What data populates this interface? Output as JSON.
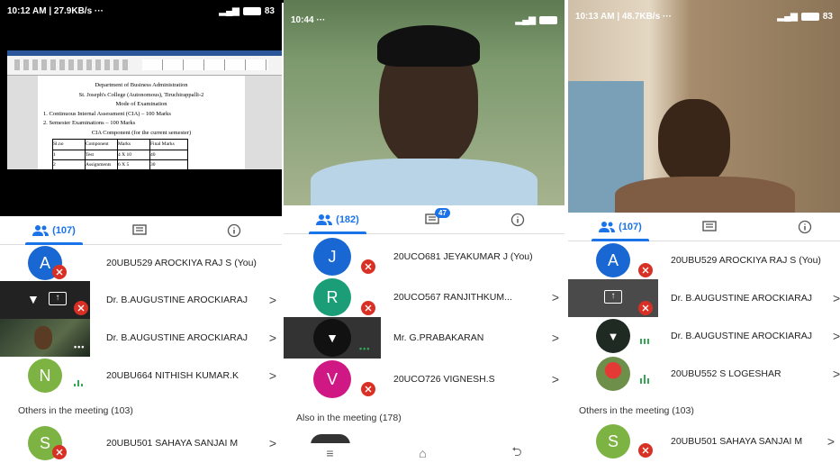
{
  "panel1": {
    "status": {
      "time": "10:12 AM | 27.9KB/s",
      "dots": "···",
      "battery": "83"
    },
    "document": {
      "lines": [
        "Department of Business Administration",
        "St. Joseph's College (Autonomous), Tiruchirappalli-2",
        "Mode of Examination",
        "1. Continuous Internal Assessment (CIA) – 100 Marks",
        "2. Semester Examinations – 100 Marks",
        "CIA Component (for the current semester)"
      ],
      "table_header": [
        "Sl.no",
        "Component",
        "Marks",
        "Final Marks"
      ],
      "table_rows": [
        [
          "1",
          "Test",
          "4 X 10",
          "40"
        ],
        [
          "2",
          "Assignments",
          "6 X 5",
          "30"
        ],
        [
          "3",
          "Final End",
          "1X30",
          "30"
        ]
      ]
    },
    "tabs": {
      "people_count": "(107)"
    },
    "rows": [
      {
        "initial": "A",
        "name": "20UBU529 AROCKIYA RAJ S (You)"
      },
      {
        "name": "Dr. B.AUGUSTINE AROCKIARAJ",
        "chevron": ">"
      },
      {
        "name": "Dr. B.AUGUSTINE AROCKIARAJ",
        "chevron": ">"
      },
      {
        "initial": "N",
        "name": "20UBU664 NITHISH KUMAR.K",
        "chevron": ">"
      }
    ],
    "section": "Others in the meeting (103)",
    "extra_row": {
      "initial": "S",
      "name": "20UBU501 SAHAYA SANJAI M",
      "chevron": ">"
    }
  },
  "panel2": {
    "status": {
      "time": "10:44",
      "dots": "···"
    },
    "tabs": {
      "people_count": "(182)",
      "chat_badge": "47"
    },
    "rows": [
      {
        "initial": "J",
        "name": "20UCO681 JEYAKUMAR J (You)"
      },
      {
        "initial": "R",
        "name": "20UCO567 RANJITHKUM...",
        "chevron": ">"
      },
      {
        "name": "Mr. G.PRABAKARAN",
        "chevron": ">"
      },
      {
        "initial": "V",
        "name": "20UCO726 VIGNESH.S",
        "chevron": ">"
      }
    ],
    "section": "Also in the meeting (178)"
  },
  "panel3": {
    "status": {
      "time": "10:13 AM | 48.7KB/s",
      "dots": "···",
      "battery": "83"
    },
    "tabs": {
      "people_count": "(107)"
    },
    "rows": [
      {
        "initial": "A",
        "name": "20UBU529 AROCKIYA RAJ S (You)"
      },
      {
        "name": "Dr. B.AUGUSTINE AROCKIARAJ",
        "chevron": ">"
      },
      {
        "name": "Dr. B.AUGUSTINE AROCKIARAJ",
        "chevron": ">"
      },
      {
        "name": "20UBU552 S LOGESHAR",
        "chevron": ">"
      }
    ],
    "section": "Others in the meeting (103)",
    "extra_row": {
      "initial": "S",
      "name": "20UBU501 SAHAYA SANJAI M",
      "chevron": ">"
    }
  },
  "colors": {
    "accent": "#1a73e8",
    "mute": "#d93025",
    "speaking": "#34a853",
    "avatar_blue": "#1967d2",
    "avatar_green": "#34a853",
    "avatar_pink": "#d01884"
  }
}
